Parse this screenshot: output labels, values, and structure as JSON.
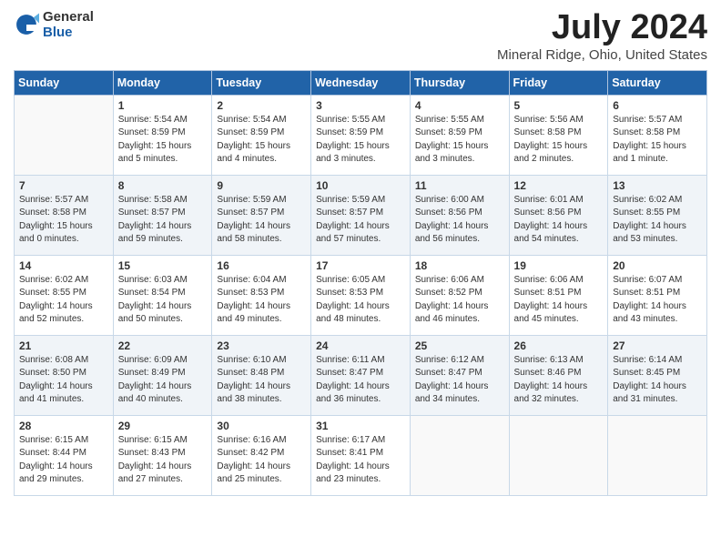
{
  "header": {
    "logo_general": "General",
    "logo_blue": "Blue",
    "month_title": "July 2024",
    "location": "Mineral Ridge, Ohio, United States"
  },
  "days_of_week": [
    "Sunday",
    "Monday",
    "Tuesday",
    "Wednesday",
    "Thursday",
    "Friday",
    "Saturday"
  ],
  "weeks": [
    [
      {
        "day": "",
        "info": ""
      },
      {
        "day": "1",
        "info": "Sunrise: 5:54 AM\nSunset: 8:59 PM\nDaylight: 15 hours\nand 5 minutes."
      },
      {
        "day": "2",
        "info": "Sunrise: 5:54 AM\nSunset: 8:59 PM\nDaylight: 15 hours\nand 4 minutes."
      },
      {
        "day": "3",
        "info": "Sunrise: 5:55 AM\nSunset: 8:59 PM\nDaylight: 15 hours\nand 3 minutes."
      },
      {
        "day": "4",
        "info": "Sunrise: 5:55 AM\nSunset: 8:59 PM\nDaylight: 15 hours\nand 3 minutes."
      },
      {
        "day": "5",
        "info": "Sunrise: 5:56 AM\nSunset: 8:58 PM\nDaylight: 15 hours\nand 2 minutes."
      },
      {
        "day": "6",
        "info": "Sunrise: 5:57 AM\nSunset: 8:58 PM\nDaylight: 15 hours\nand 1 minute."
      }
    ],
    [
      {
        "day": "7",
        "info": "Sunrise: 5:57 AM\nSunset: 8:58 PM\nDaylight: 15 hours\nand 0 minutes."
      },
      {
        "day": "8",
        "info": "Sunrise: 5:58 AM\nSunset: 8:57 PM\nDaylight: 14 hours\nand 59 minutes."
      },
      {
        "day": "9",
        "info": "Sunrise: 5:59 AM\nSunset: 8:57 PM\nDaylight: 14 hours\nand 58 minutes."
      },
      {
        "day": "10",
        "info": "Sunrise: 5:59 AM\nSunset: 8:57 PM\nDaylight: 14 hours\nand 57 minutes."
      },
      {
        "day": "11",
        "info": "Sunrise: 6:00 AM\nSunset: 8:56 PM\nDaylight: 14 hours\nand 56 minutes."
      },
      {
        "day": "12",
        "info": "Sunrise: 6:01 AM\nSunset: 8:56 PM\nDaylight: 14 hours\nand 54 minutes."
      },
      {
        "day": "13",
        "info": "Sunrise: 6:02 AM\nSunset: 8:55 PM\nDaylight: 14 hours\nand 53 minutes."
      }
    ],
    [
      {
        "day": "14",
        "info": "Sunrise: 6:02 AM\nSunset: 8:55 PM\nDaylight: 14 hours\nand 52 minutes."
      },
      {
        "day": "15",
        "info": "Sunrise: 6:03 AM\nSunset: 8:54 PM\nDaylight: 14 hours\nand 50 minutes."
      },
      {
        "day": "16",
        "info": "Sunrise: 6:04 AM\nSunset: 8:53 PM\nDaylight: 14 hours\nand 49 minutes."
      },
      {
        "day": "17",
        "info": "Sunrise: 6:05 AM\nSunset: 8:53 PM\nDaylight: 14 hours\nand 48 minutes."
      },
      {
        "day": "18",
        "info": "Sunrise: 6:06 AM\nSunset: 8:52 PM\nDaylight: 14 hours\nand 46 minutes."
      },
      {
        "day": "19",
        "info": "Sunrise: 6:06 AM\nSunset: 8:51 PM\nDaylight: 14 hours\nand 45 minutes."
      },
      {
        "day": "20",
        "info": "Sunrise: 6:07 AM\nSunset: 8:51 PM\nDaylight: 14 hours\nand 43 minutes."
      }
    ],
    [
      {
        "day": "21",
        "info": "Sunrise: 6:08 AM\nSunset: 8:50 PM\nDaylight: 14 hours\nand 41 minutes."
      },
      {
        "day": "22",
        "info": "Sunrise: 6:09 AM\nSunset: 8:49 PM\nDaylight: 14 hours\nand 40 minutes."
      },
      {
        "day": "23",
        "info": "Sunrise: 6:10 AM\nSunset: 8:48 PM\nDaylight: 14 hours\nand 38 minutes."
      },
      {
        "day": "24",
        "info": "Sunrise: 6:11 AM\nSunset: 8:47 PM\nDaylight: 14 hours\nand 36 minutes."
      },
      {
        "day": "25",
        "info": "Sunrise: 6:12 AM\nSunset: 8:47 PM\nDaylight: 14 hours\nand 34 minutes."
      },
      {
        "day": "26",
        "info": "Sunrise: 6:13 AM\nSunset: 8:46 PM\nDaylight: 14 hours\nand 32 minutes."
      },
      {
        "day": "27",
        "info": "Sunrise: 6:14 AM\nSunset: 8:45 PM\nDaylight: 14 hours\nand 31 minutes."
      }
    ],
    [
      {
        "day": "28",
        "info": "Sunrise: 6:15 AM\nSunset: 8:44 PM\nDaylight: 14 hours\nand 29 minutes."
      },
      {
        "day": "29",
        "info": "Sunrise: 6:15 AM\nSunset: 8:43 PM\nDaylight: 14 hours\nand 27 minutes."
      },
      {
        "day": "30",
        "info": "Sunrise: 6:16 AM\nSunset: 8:42 PM\nDaylight: 14 hours\nand 25 minutes."
      },
      {
        "day": "31",
        "info": "Sunrise: 6:17 AM\nSunset: 8:41 PM\nDaylight: 14 hours\nand 23 minutes."
      },
      {
        "day": "",
        "info": ""
      },
      {
        "day": "",
        "info": ""
      },
      {
        "day": "",
        "info": ""
      }
    ]
  ]
}
